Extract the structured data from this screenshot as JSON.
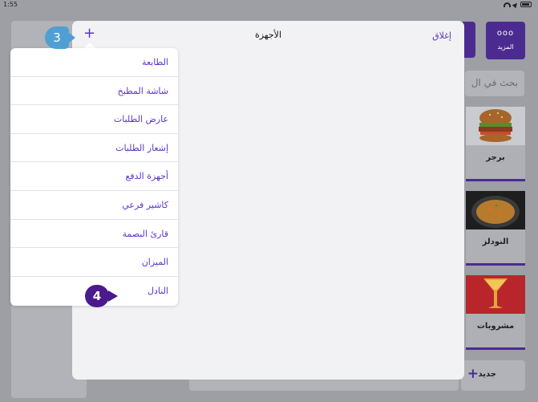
{
  "status_bar": {
    "time": "1:55"
  },
  "background": {
    "more_button": {
      "dots": "ooo",
      "label": "المزيد"
    },
    "search_placeholder": "بحث في ال",
    "categories": [
      {
        "label": "برجر"
      },
      {
        "label": "النودلز"
      },
      {
        "label": "مشروبات"
      }
    ],
    "new_button": {
      "label": "جديد",
      "plus": "+"
    }
  },
  "modal": {
    "title": "الأجهزة",
    "close_label": "إغلاق",
    "add_symbol": "+"
  },
  "steps": {
    "step3": "3",
    "step4": "4"
  },
  "dropdown": {
    "items": [
      {
        "label": "الطابعة"
      },
      {
        "label": "شاشة المطبخ"
      },
      {
        "label": "عارض الطلبات"
      },
      {
        "label": "إشعار الطلبات"
      },
      {
        "label": "أجهزة الدفع"
      },
      {
        "label": "كاشير فرعي"
      },
      {
        "label": "قارئ البصمة"
      },
      {
        "label": "الميزان"
      },
      {
        "label": "النادل"
      }
    ]
  },
  "colors": {
    "accent": "#5b35c9",
    "brand_purple": "#4c2b91",
    "step3_badge": "#4f9fd4",
    "step4_badge": "#4b1a8d"
  }
}
